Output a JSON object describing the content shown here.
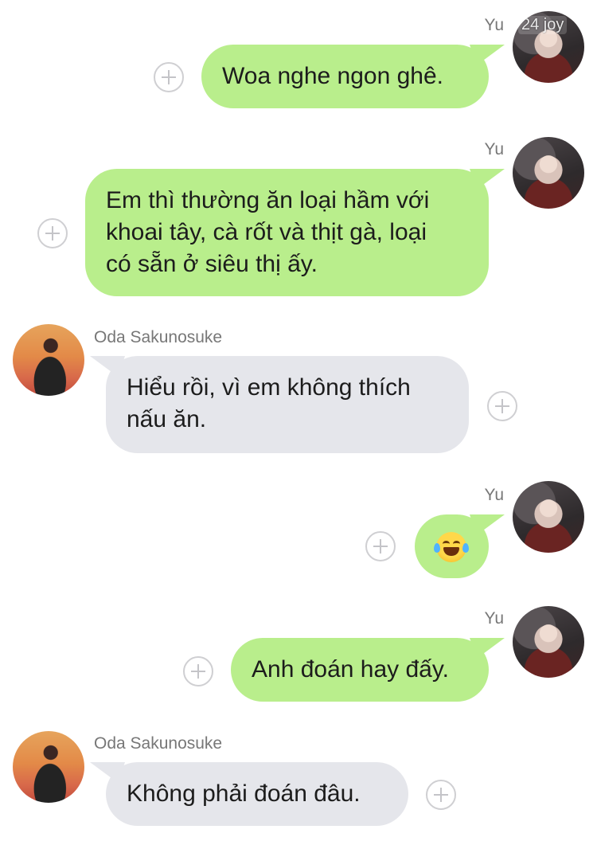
{
  "contacts": {
    "yu": {
      "name": "Yu",
      "avatar_icon": "yu-avatar-icon",
      "badge": "24 joy"
    },
    "oda": {
      "name": "Oda Sakunosuke",
      "avatar_icon": "oda-avatar-icon"
    }
  },
  "colors": {
    "sent_bubble": "#b9ee8c",
    "received_bubble": "#e5e6eb",
    "sender_name": "#777777"
  },
  "messages": [
    {
      "sender": "Yu",
      "direction": "sent",
      "lines": [
        "Woa nghe ngon ghê."
      ]
    },
    {
      "sender": "Yu",
      "direction": "sent",
      "lines": [
        "Em thì thường ăn loại hầm với",
        "khoai tây, cà rốt và thịt gà, loại",
        "có sẵn ở siêu thị ấy."
      ]
    },
    {
      "sender": "Oda Sakunosuke",
      "direction": "received",
      "lines": [
        "Hiểu rồi, vì em không thích",
        "nấu ăn."
      ]
    },
    {
      "sender": "Yu",
      "direction": "sent",
      "emoji": "face-with-tears-of-joy-icon"
    },
    {
      "sender": "Yu",
      "direction": "sent",
      "lines": [
        "Anh đoán hay đấy."
      ]
    },
    {
      "sender": "Oda Sakunosuke",
      "direction": "received",
      "lines": [
        "Không phải đoán đâu."
      ]
    }
  ]
}
